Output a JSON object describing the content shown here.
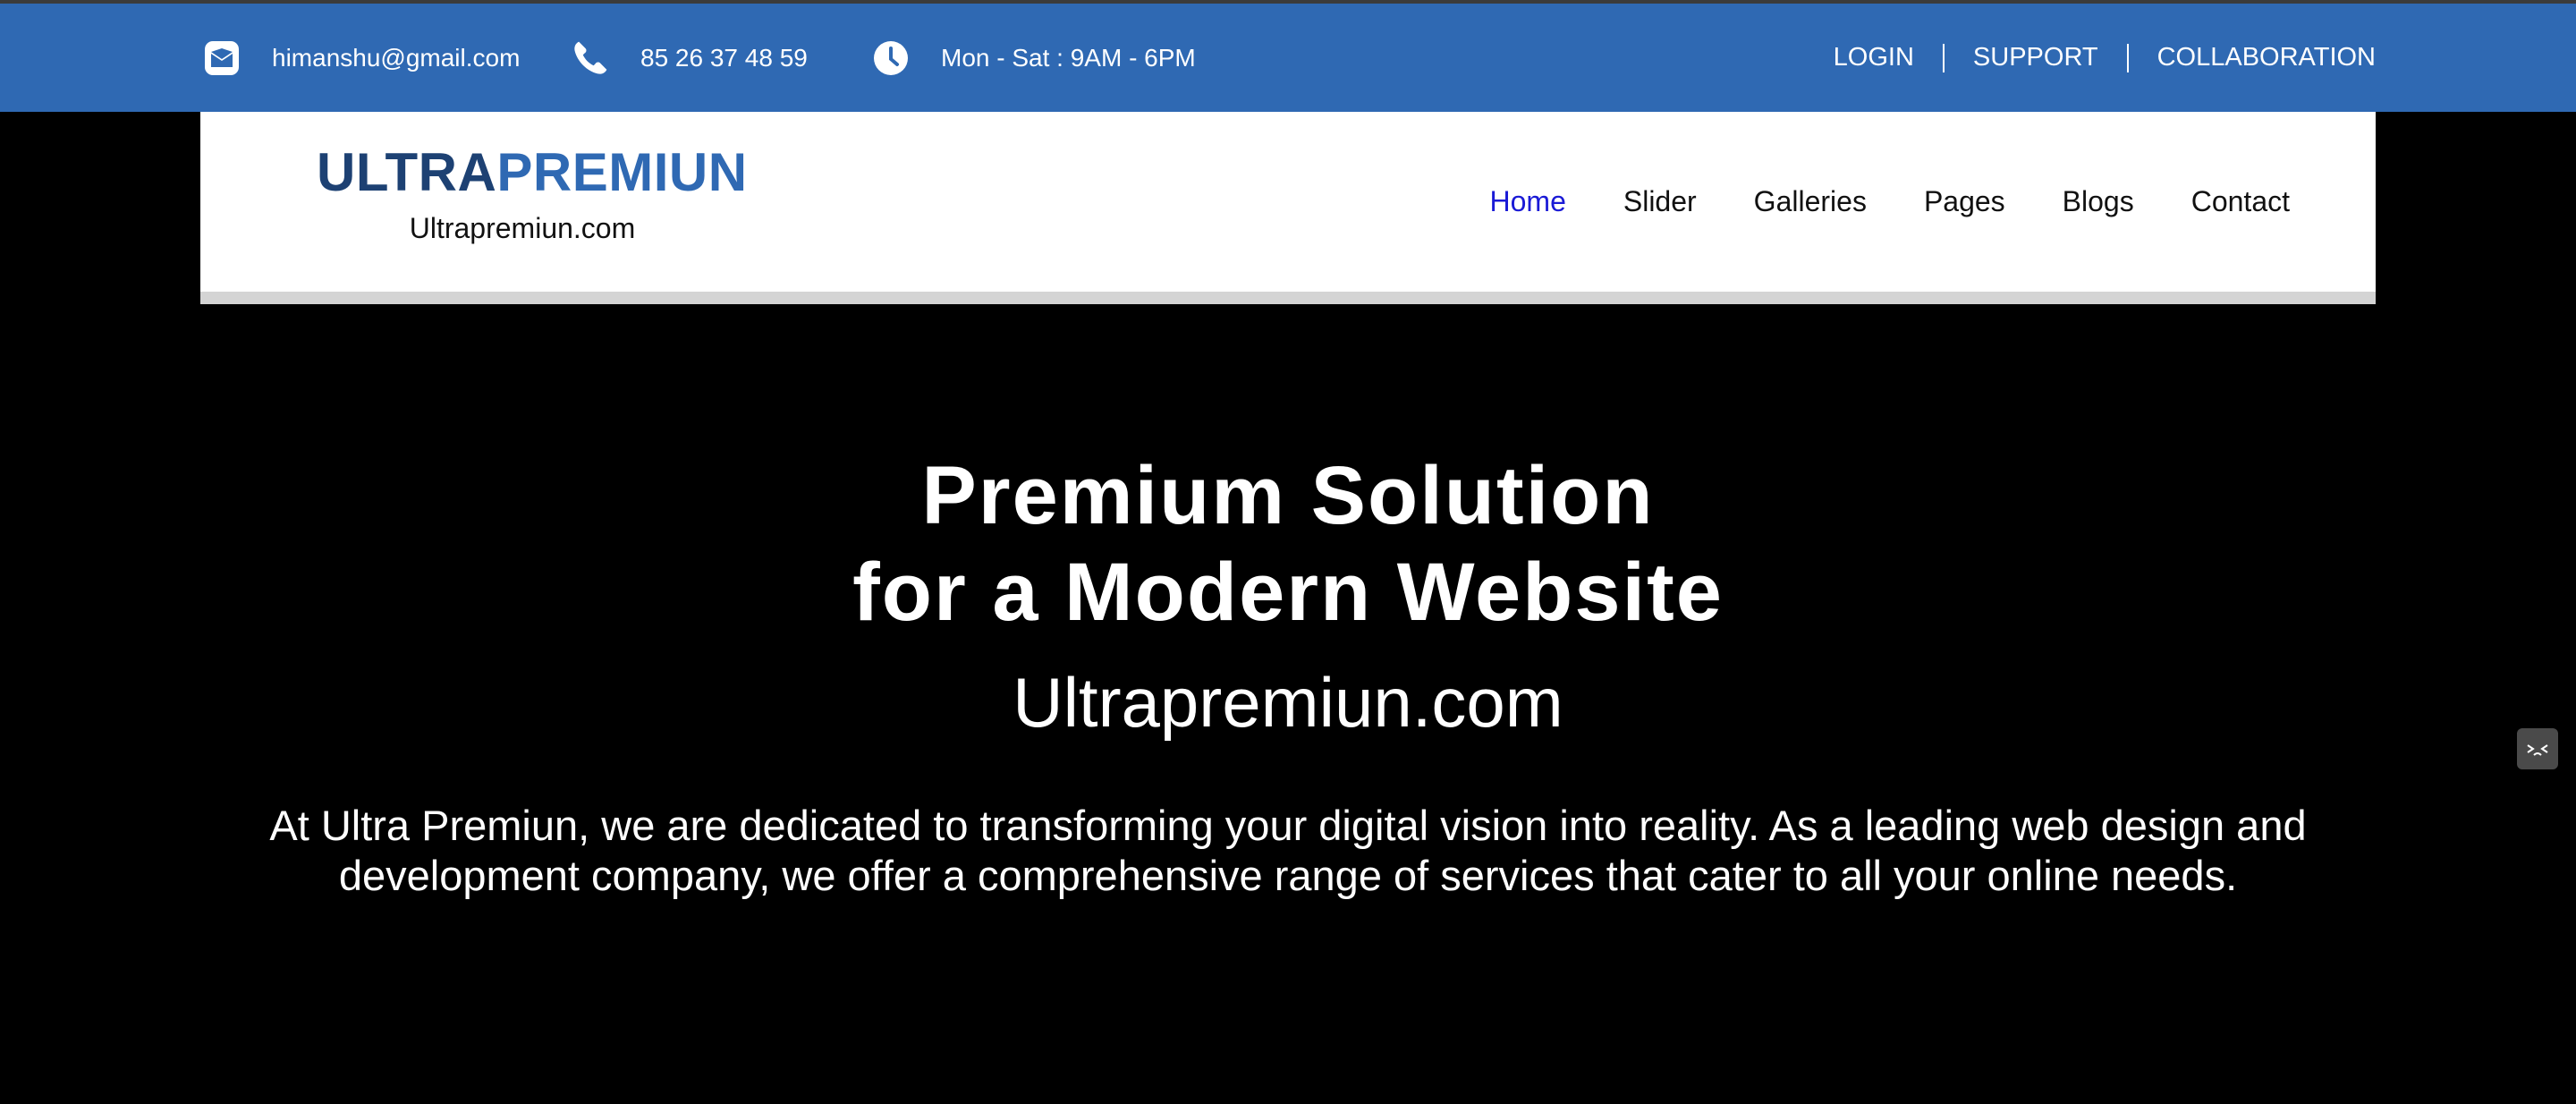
{
  "topbar": {
    "email": "himanshu@gmail.com",
    "phone": "85 26 37 48 59",
    "hours": "Mon - Sat : 9AM - 6PM",
    "links": [
      "LOGIN",
      "SUPPORT",
      "COLLABORATION"
    ],
    "icons": [
      "envelope-icon",
      "phone-icon",
      "clock-icon"
    ]
  },
  "logo": {
    "part1": "ULTRA",
    "part2": "PREMIUN",
    "subtitle": "Ultrapremiun.com"
  },
  "nav": {
    "items": [
      "Home",
      "Slider",
      "Galleries",
      "Pages",
      "Blogs",
      "Contact"
    ],
    "active": "Home"
  },
  "hero": {
    "title_line1": "Premium Solution",
    "title_line2": "for a Modern Website",
    "subtitle": "Ultrapremiun.com",
    "text": "At Ultra Premiun, we are dedicated to transforming your digital vision into reality. As a leading web design and development company, we offer a comprehensive range of services that cater to all your online needs."
  },
  "colors": {
    "topbar": "#2f69b3",
    "logo_dark": "#1d4173",
    "logo_light": "#2f69b3",
    "nav_active": "#1a1ad6"
  }
}
